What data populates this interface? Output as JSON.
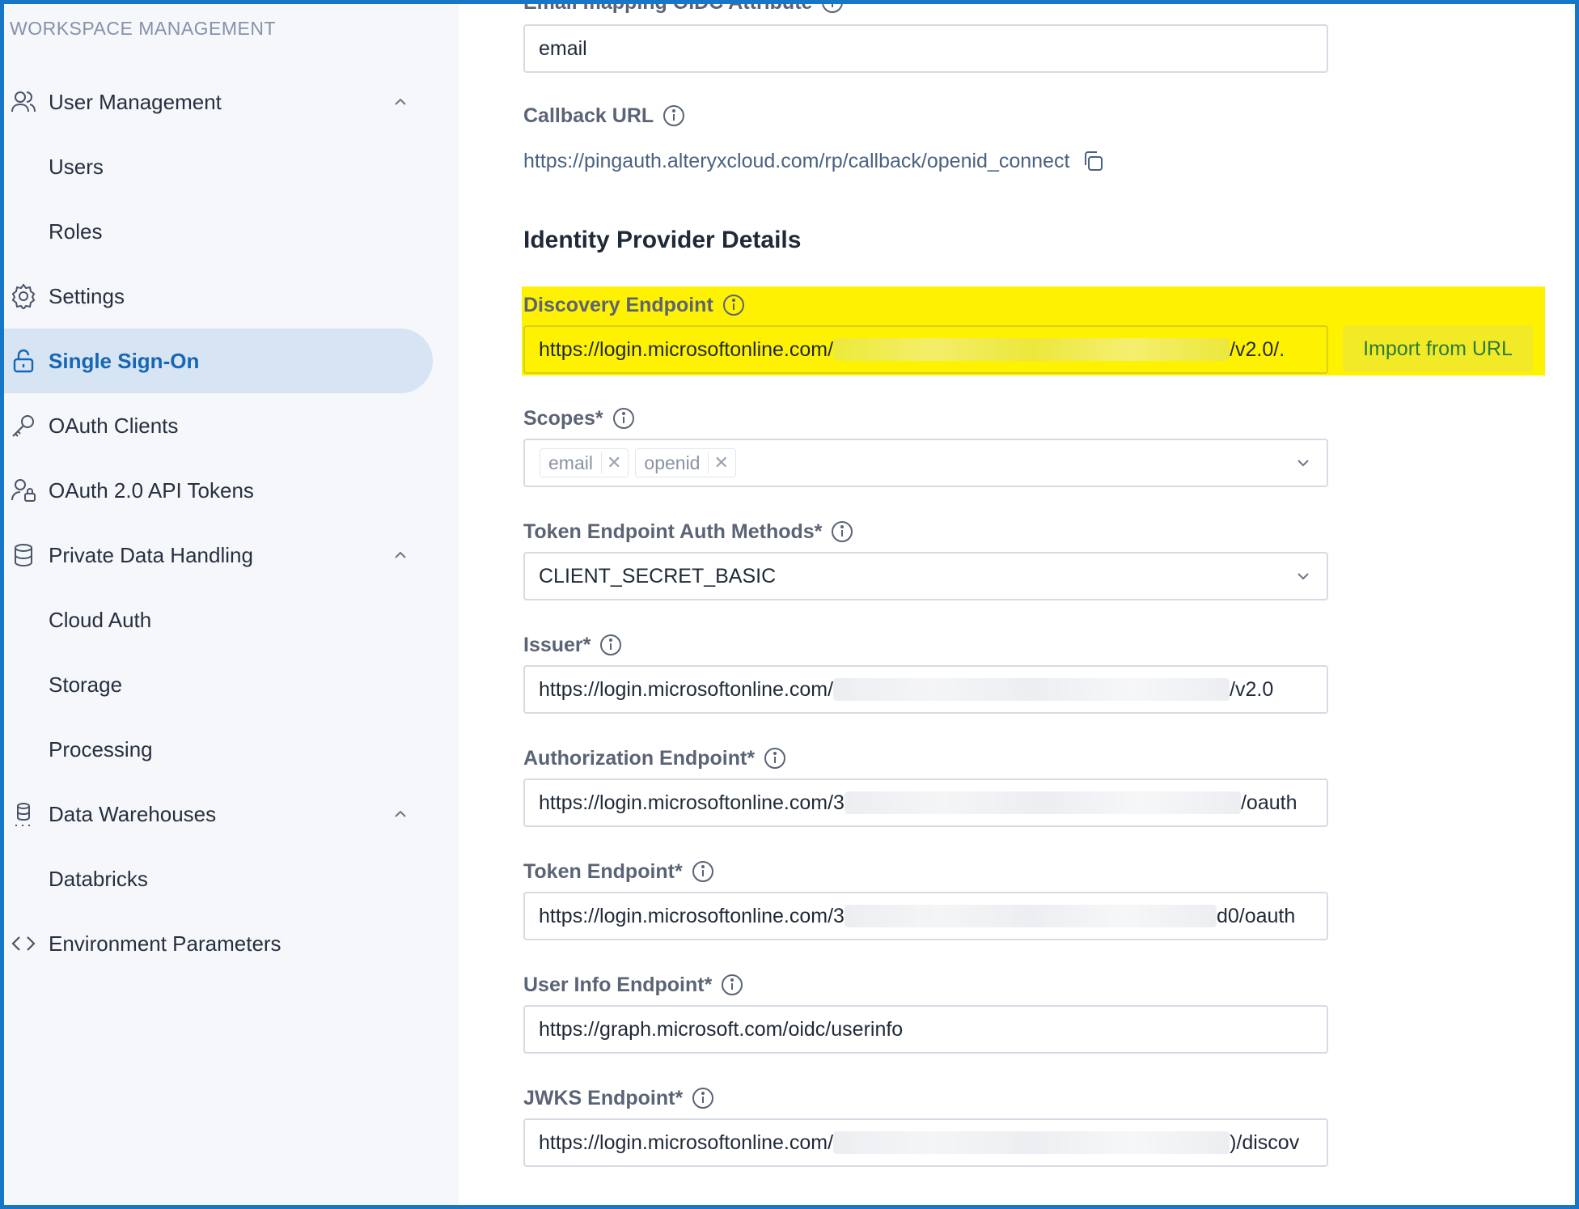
{
  "sidebar": {
    "title": "WORKSPACE MANAGEMENT",
    "user_management": "User Management",
    "users": "Users",
    "roles": "Roles",
    "settings": "Settings",
    "single_sign_on": "Single Sign-On",
    "oauth_clients": "OAuth Clients",
    "oauth_tokens": "OAuth 2.0 API Tokens",
    "private_data": "Private Data Handling",
    "cloud_auth": "Cloud Auth",
    "storage": "Storage",
    "processing": "Processing",
    "data_warehouses": "Data Warehouses",
    "databricks": "Databricks",
    "env_params": "Environment Parameters"
  },
  "form": {
    "email_label": "Email mapping OIDC Attribute",
    "email_value": "email",
    "callback_label": "Callback URL",
    "callback_url": "https://pingauth.alteryxcloud.com/rp/callback/openid_connect",
    "idp_title": "Identity Provider Details",
    "discovery_label": "Discovery Endpoint",
    "discovery_prefix": "https://login.microsoftonline.com/",
    "discovery_suffix": "/v2.0/.",
    "import_label": "Import from URL",
    "scopes_label": "Scopes*",
    "scope_chips": [
      "email",
      "openid"
    ],
    "token_auth_label": "Token Endpoint Auth Methods*",
    "token_auth_value": "CLIENT_SECRET_BASIC",
    "issuer_label": "Issuer*",
    "issuer_prefix": "https://login.microsoftonline.com/",
    "issuer_suffix": "/v2.0",
    "authz_label": "Authorization Endpoint*",
    "authz_prefix": "https://login.microsoftonline.com/3",
    "authz_suffix": "/oauth",
    "token_label": "Token Endpoint*",
    "token_prefix": "https://login.microsoftonline.com/3",
    "token_suffix": "d0/oauth",
    "userinfo_label": "User Info Endpoint*",
    "userinfo_value": "https://graph.microsoft.com/oidc/userinfo",
    "jwks_label": "JWKS Endpoint*",
    "jwks_prefix": "https://login.microsoftonline.com/",
    "jwks_suffix": ")/discov"
  },
  "colors": {
    "active_nav_bg": "#d6e4f4",
    "accent": "#1666b5",
    "highlight": "#fff200"
  }
}
